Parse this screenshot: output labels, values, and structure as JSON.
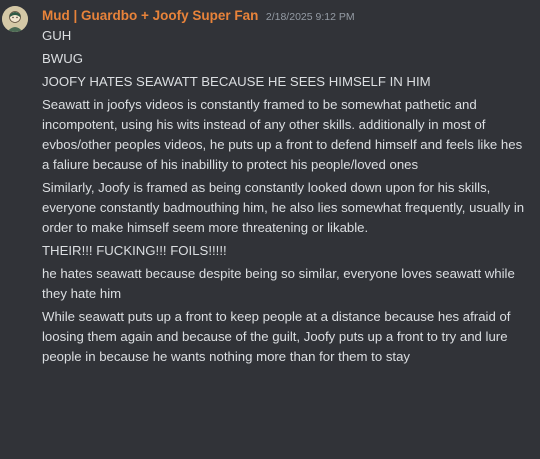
{
  "author": {
    "username": "Mud | Guardbo + Joofy Super Fan",
    "timestamp": "2/18/2025 9:12 PM",
    "name_color": "#e8833a",
    "avatar_icon": "user-avatar"
  },
  "messages": [
    "GUH",
    "BWUG",
    "JOOFY HATES SEAWATT BECAUSE HE SEES HIMSELF IN HIM",
    "Seawatt in joofys videos is constantly framed to be somewhat pathetic and incompotent, using his wits instead of any other skills. additionally in most of evbos/other peoples videos, he puts up a front to defend himself and feels like hes a faliure because of his inabillity to protect his people/loved ones",
    "Similarly, Joofy is framed as being constantly looked down upon for his skills, everyone constantly badmouthing him, he also lies somewhat frequently, usually in order to make himself seem more threatening or likable.",
    "THEIR!!! FUCKING!!!  FOILS!!!!!",
    "he hates seawatt because despite being so similar, everyone loves seawatt while they hate him",
    "While seawatt puts up a front to keep people at a distance because hes afraid of loosing them again and because of the guilt, Joofy puts up a front to try and lure people in because he wants nothing more than for them to stay"
  ],
  "colors": {
    "background": "#313338",
    "text": "#dbdee1",
    "timestamp": "#949ba4"
  }
}
